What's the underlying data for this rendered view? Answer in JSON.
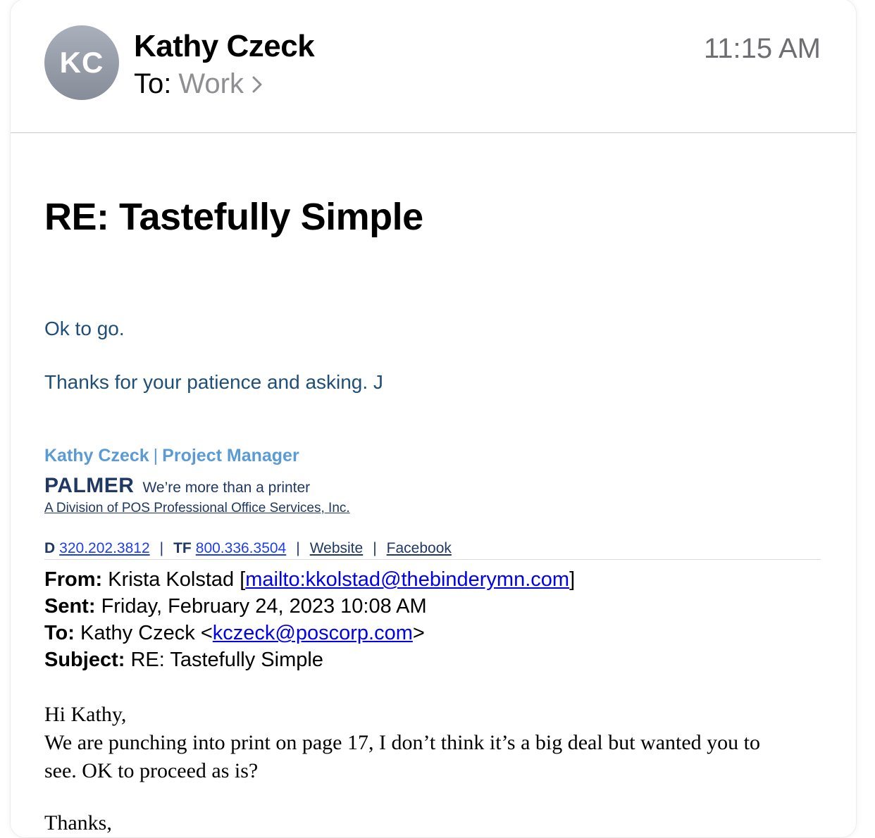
{
  "header": {
    "avatar_initials": "KC",
    "sender_name": "Kathy Czeck",
    "to_label": "To:",
    "to_value": "Work",
    "time": "11:15 AM"
  },
  "email": {
    "subject": "RE: Tastefully Simple",
    "body_line1": "Ok to go.",
    "body_line2": "Thanks for your patience and asking. J"
  },
  "signature": {
    "name": "Kathy Czeck",
    "separator": "|",
    "title": "Project Manager",
    "company": "PALMER",
    "tagline": "We’re more than a printer",
    "division": "A Division of POS Professional Office Services, Inc.",
    "direct_label": "D",
    "direct_phone": "320.202.3812",
    "tollfree_label": "TF",
    "tollfree_phone": "800.336.3504",
    "website_label": "Website",
    "facebook_label": "Facebook",
    "pipe": "|"
  },
  "quoted": {
    "from_label": "From:",
    "from_name": "Krista Kolstad [",
    "from_link": "mailto:kkolstad@thebinderymn.com",
    "from_end": "]",
    "sent_label": "Sent:",
    "sent_value": "Friday, February 24, 2023 10:08 AM",
    "to_label": "To:",
    "to_name": "Kathy Czeck <",
    "to_link": "kczeck@poscorp.com",
    "to_end": ">",
    "subject_label": "Subject:",
    "subject_value": "RE: Tastefully Simple",
    "greeting": "Hi Kathy,",
    "message_line1": "We are punching into print on page 17, I don’t think it’s a big deal but wanted you to",
    "message_line2": "see.  OK to proceed as is?",
    "closing": "Thanks,"
  },
  "colors": {
    "body_blue": "#1f4e79",
    "signature_light_blue": "#5b9bd5",
    "palmer_navy": "#1f3864",
    "link_blue": "#0000ee",
    "gray_text": "#8e8e93"
  }
}
